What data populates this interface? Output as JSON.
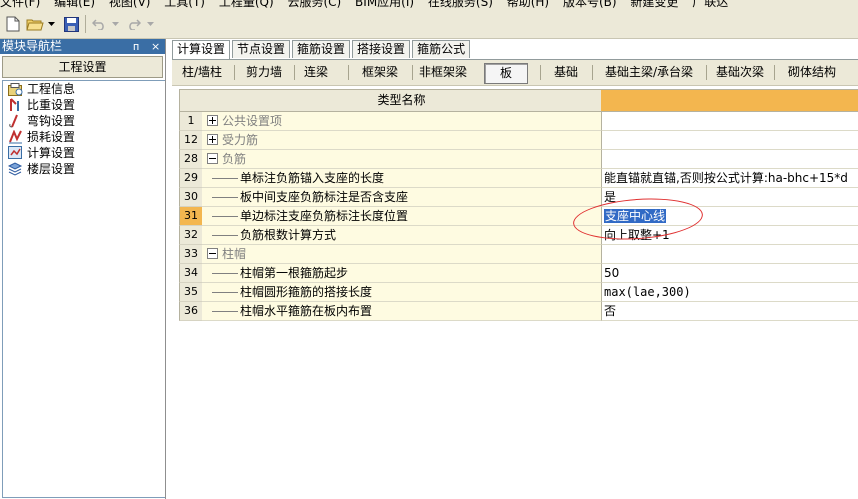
{
  "menubar": {
    "items": [
      "文件(F)",
      "编辑(E)",
      "视图(V)",
      "工具(T)",
      "工程量(Q)",
      "云服务(C)",
      "BIM应用(I)",
      "在线服务(S)",
      "帮助(H)",
      "版本号(B)",
      "新建变更",
      "广联达"
    ]
  },
  "toolbar": {
    "buttons": [
      "new-file-icon",
      "open-folder-icon",
      "dropdown-arrow-icon",
      "save-icon",
      "undo-icon",
      "dropdown-arrow-icon",
      "redo-icon",
      "dropdown-arrow-icon"
    ]
  },
  "nav": {
    "title": "模块导航栏",
    "pin": "ᴨ",
    "close": "×",
    "header": "工程设置",
    "items": [
      {
        "label": "工程信息",
        "icon": "project-info-icon"
      },
      {
        "label": "比重设置",
        "icon": "weight-setting-icon"
      },
      {
        "label": "弯钩设置",
        "icon": "hook-setting-icon"
      },
      {
        "label": "损耗设置",
        "icon": "loss-setting-icon"
      },
      {
        "label": "计算设置",
        "icon": "calc-setting-icon"
      },
      {
        "label": "楼层设置",
        "icon": "floor-setting-icon"
      }
    ]
  },
  "tabs": [
    "计算设置",
    "节点设置",
    "箍筋设置",
    "搭接设置",
    "箍筋公式"
  ],
  "subtabs": [
    "柱/墙柱",
    "剪力墙",
    "连梁",
    "框架梁",
    "非框架梁",
    "板",
    "基础",
    "基础主梁/承台梁",
    "基础次梁",
    "砌体结构"
  ],
  "grid": {
    "header": "类型名称",
    "rows": [
      {
        "num": "1",
        "name": "公共设置项",
        "value": "",
        "type": "group",
        "expander": "plus"
      },
      {
        "num": "12",
        "name": "受力筋",
        "value": "",
        "type": "group",
        "expander": "plus"
      },
      {
        "num": "28",
        "name": "负筋",
        "value": "",
        "type": "groupopen",
        "expander": "minus"
      },
      {
        "num": "29",
        "name": "单标注负筋锚入支座的长度",
        "value": "能直锚就直锚,否则按公式计算:ha-bhc+15*d",
        "type": "child"
      },
      {
        "num": "30",
        "name": "板中间支座负筋标注是否含支座",
        "value": "是",
        "type": "child"
      },
      {
        "num": "31",
        "name": "单边标注支座负筋标注长度位置",
        "value": "支座中心线",
        "type": "child",
        "selected": true
      },
      {
        "num": "32",
        "name": "负筋根数计算方式",
        "value": "向上取整+1",
        "type": "child"
      },
      {
        "num": "33",
        "name": "柱帽",
        "value": "",
        "type": "group",
        "expander": "minus"
      },
      {
        "num": "34",
        "name": "柱帽第一根箍筋起步",
        "value": "50",
        "type": "child"
      },
      {
        "num": "35",
        "name": "柱帽圆形箍筋的搭接长度",
        "value": "max(lae,300)",
        "type": "child"
      },
      {
        "num": "36",
        "name": "柱帽水平箍筋在板内布置",
        "value": "否",
        "type": "child"
      }
    ]
  },
  "colors": {
    "selection": "#316ac5",
    "header_accent": "#f3b64f",
    "annotation": "#e03030",
    "cell_bg": "#fefbe1"
  }
}
